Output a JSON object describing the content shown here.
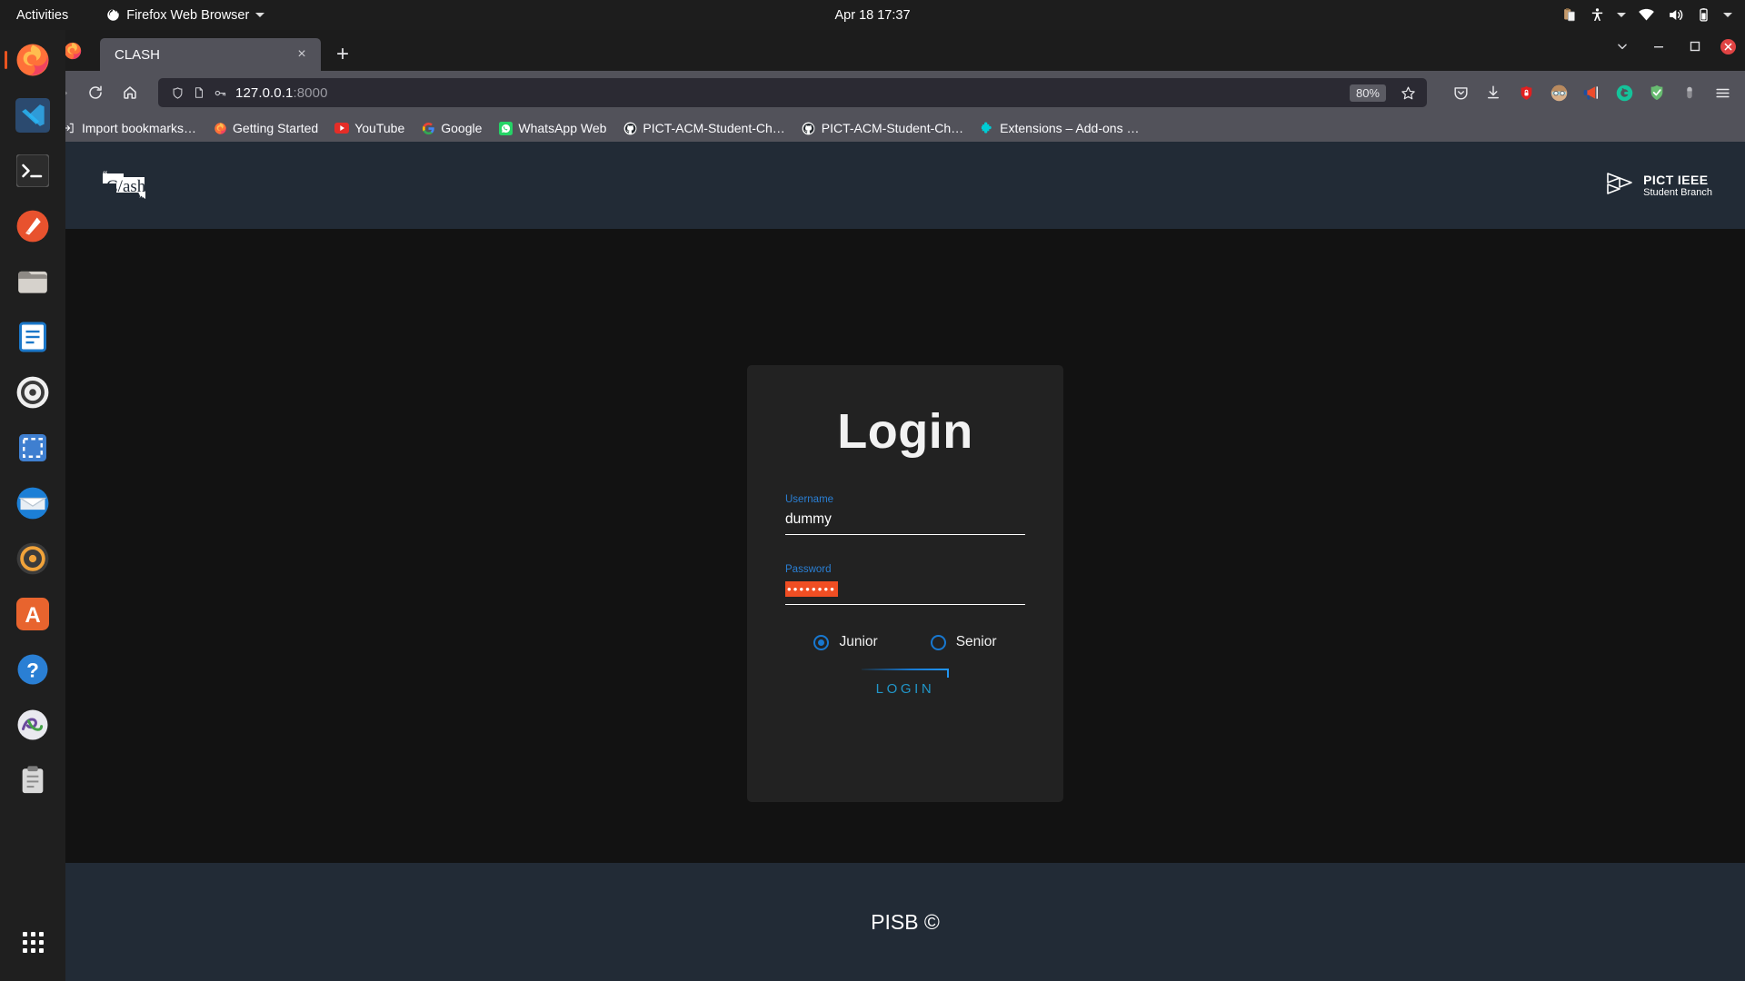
{
  "desktop": {
    "activities": "Activities",
    "app_menu": "Firefox Web Browser",
    "clock": "Apr 18  17:37",
    "tray_icons": [
      "clipboard-icon",
      "accessibility-icon",
      "tray-caret-icon",
      "wifi-icon",
      "volume-icon",
      "battery-icon",
      "system-menu-caret-icon"
    ]
  },
  "dock": {
    "items": [
      {
        "name": "firefox",
        "label": "Firefox"
      },
      {
        "name": "vscode",
        "label": "Visual Studio Code"
      },
      {
        "name": "terminal",
        "label": "Terminal"
      },
      {
        "name": "inkscape",
        "label": "Inkscape"
      },
      {
        "name": "files",
        "label": "Files"
      },
      {
        "name": "libreoffice-writer",
        "label": "LibreOffice Writer"
      },
      {
        "name": "settings",
        "label": "Settings"
      },
      {
        "name": "screenshot",
        "label": "Screenshot"
      },
      {
        "name": "thunderbird",
        "label": "Thunderbird Mail"
      },
      {
        "name": "rhythmbox",
        "label": "Rhythmbox"
      },
      {
        "name": "ubuntu-software",
        "label": "Ubuntu Software"
      },
      {
        "name": "help",
        "label": "Help"
      },
      {
        "name": "anaconda",
        "label": "Anaconda Navigator"
      },
      {
        "name": "clipboard-manager",
        "label": "Clipboard"
      }
    ],
    "show_apps_label": "Show Applications"
  },
  "browser": {
    "tab": {
      "title": "CLASH",
      "close_label": "×",
      "new_tab_label": "+"
    },
    "window_controls": {
      "list_tabs": "⌵",
      "minimize": "—",
      "maximize": "❐",
      "close": "×"
    },
    "nav": {
      "back": "back-button",
      "forward": "forward-button",
      "reload": "reload-button",
      "home": "home-button"
    },
    "urlbar": {
      "url_host": "127.0.0.1",
      "url_port": ":8000",
      "zoom_level": "80%",
      "icons": [
        "shield-icon",
        "page-info-icon",
        "key-icon"
      ],
      "bookmark_star": "star-icon"
    },
    "extensions": [
      {
        "name": "pocket-icon",
        "label": "Save to Pocket"
      },
      {
        "name": "download-icon",
        "label": "Downloads"
      },
      {
        "name": "shield-lock-icon",
        "label": "Privacy Badger"
      },
      {
        "name": "avatar-icon",
        "label": "Account"
      },
      {
        "name": "megaphone-icon",
        "label": "Announcements"
      },
      {
        "name": "grammarly-icon",
        "label": "Grammarly"
      },
      {
        "name": "adguard-icon",
        "label": "AdGuard"
      },
      {
        "name": "capsule-icon",
        "label": "Extension"
      },
      {
        "name": "hamburger-menu-icon",
        "label": "Open application menu"
      }
    ],
    "bookmarks": [
      {
        "label": "Import bookmarks…",
        "icon": "import-icon"
      },
      {
        "label": "Getting Started",
        "icon": "firefox-icon"
      },
      {
        "label": "YouTube",
        "icon": "youtube-icon"
      },
      {
        "label": "Google",
        "icon": "google-icon"
      },
      {
        "label": "WhatsApp Web",
        "icon": "whatsapp-icon"
      },
      {
        "label": "PICT-ACM-Student-Ch…",
        "icon": "github-icon"
      },
      {
        "label": "PICT-ACM-Student-Ch…",
        "icon": "github-icon"
      },
      {
        "label": "Extensions – Add-ons …",
        "icon": "puzzle-icon"
      }
    ]
  },
  "site": {
    "header": {
      "brand_logo": "C/ash",
      "brand_quote_open": "“",
      "brand_quote_close": "”",
      "org_line1": "PICT IEEE",
      "org_line2": "Student Branch"
    },
    "login": {
      "title": "Login",
      "username_label": "Username",
      "username_value": "dummy",
      "username_placeholder": "",
      "password_label": "Password",
      "password_value": "••••••••",
      "password_placeholder": "",
      "roles": [
        {
          "label": "Junior",
          "selected": true
        },
        {
          "label": "Senior",
          "selected": false
        }
      ],
      "submit_label": "LOGIN"
    },
    "footer": {
      "text": "PISB ©"
    },
    "colors": {
      "header_bg": "#222b36",
      "page_bg": "#121212",
      "card_bg": "#222222",
      "label_blue": "#2a7fd4",
      "accent_cyan": "#2196c9",
      "selection_orange": "#f04e23",
      "radio_blue": "#1878d0"
    }
  }
}
